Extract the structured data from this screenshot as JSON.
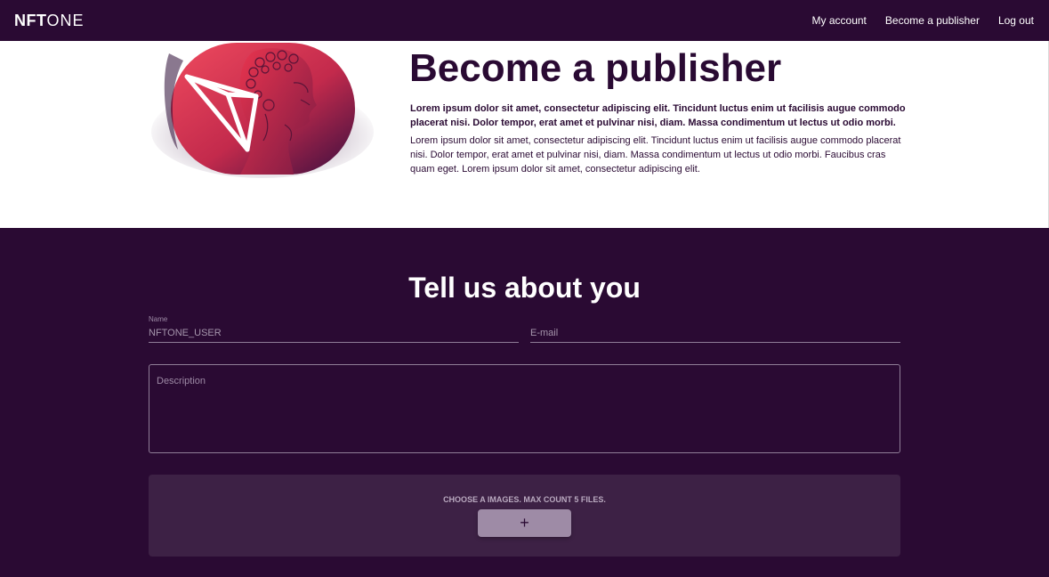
{
  "header": {
    "logo_bold": "NFT",
    "logo_light": "ONE",
    "nav": [
      {
        "label": "My account"
      },
      {
        "label": "Become a publisher"
      },
      {
        "label": "Log out"
      }
    ]
  },
  "hero": {
    "title": "Become a publisher",
    "lead": "Lorem ipsum dolor sit amet, consectetur adipiscing elit. Tincidunt luctus enim ut facilisis augue commodo placerat nisi. Dolor tempor, erat amet et pulvinar nisi, diam. Massa condimentum ut lectus ut odio morbi.",
    "body": "Lorem ipsum dolor sit amet, consectetur adipiscing elit. Tincidunt luctus enim ut facilisis augue commodo placerat nisi. Dolor tempor, erat amet et pulvinar nisi, diam. Massa condimentum ut lectus ut odio morbi. Faucibus cras quam eget. Lorem ipsum dolor sit amet, consectetur adipiscing elit."
  },
  "form": {
    "title": "Tell us about you",
    "name_label": "Name",
    "name_value": "NFTONE_USER",
    "email_placeholder": "E-mail",
    "description_placeholder": "Description",
    "upload_note": "CHOOSE A IMAGES. MAX COUNT 5 FILES.",
    "upload_button": "+"
  },
  "colors": {
    "background_dark": "#2a0a33",
    "upload_panel": "#3d2145",
    "accent_red": "#e8344e",
    "button": "#9e8ba6"
  }
}
